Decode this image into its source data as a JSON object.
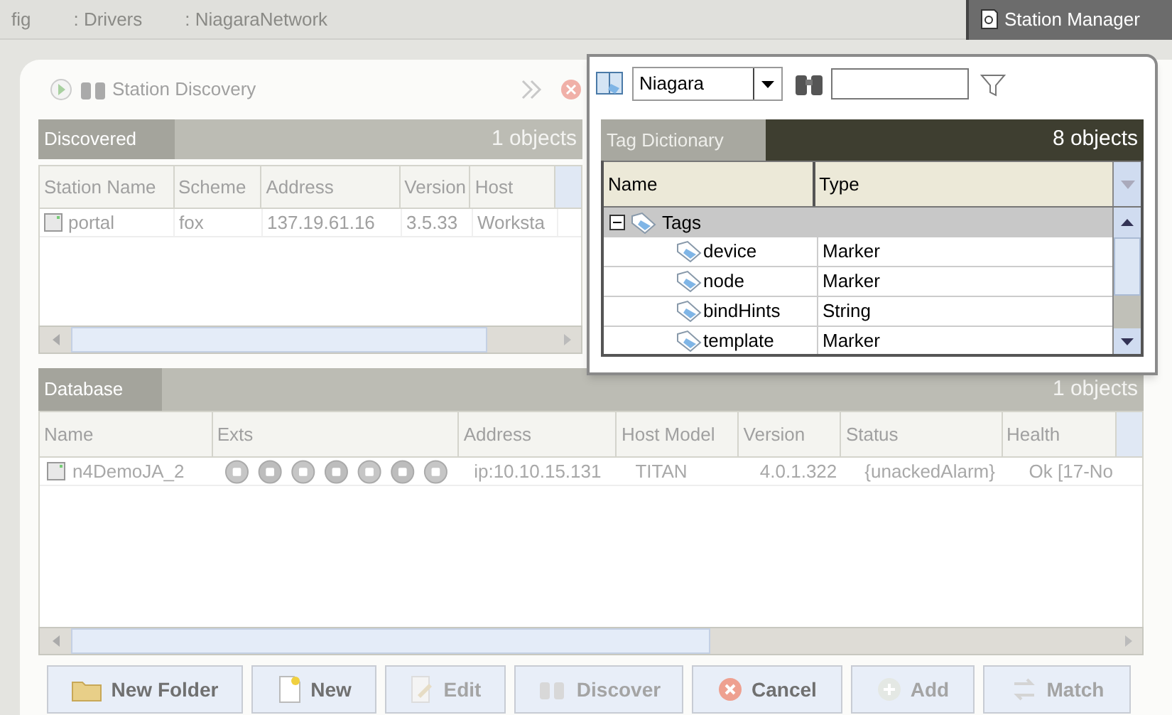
{
  "breadcrumb": [
    "fig",
    ": Drivers",
    ": NiagaraNetwork"
  ],
  "station_manager": "Station Manager",
  "discovery": {
    "title": "Station Discovery",
    "tab": "Discovered",
    "count": "1 objects",
    "columns": [
      "Station Name",
      "Scheme",
      "Address",
      "Version",
      "Host"
    ],
    "rows": [
      [
        "portal",
        "fox",
        "137.19.61.16",
        "3.5.33",
        "Worksta"
      ]
    ]
  },
  "database": {
    "tab": "Database",
    "count": "1 objects",
    "columns": [
      "Name",
      "Exts",
      "Address",
      "Host Model",
      "Version",
      "Status",
      "Health"
    ],
    "rows": [
      {
        "name": "n4DemoJA_2",
        "address": "ip:10.10.15.131",
        "host_model": "TITAN",
        "version": "4.0.1.322",
        "status": "{unackedAlarm}",
        "health": "Ok [17-No"
      }
    ]
  },
  "buttons": [
    {
      "label": "New Folder",
      "kind": "folder",
      "disabled": false
    },
    {
      "label": "New",
      "kind": "new",
      "disabled": false
    },
    {
      "label": "Edit",
      "kind": "edit",
      "disabled": true
    },
    {
      "label": "Discover",
      "kind": "discover",
      "disabled": true
    },
    {
      "label": "Cancel",
      "kind": "cancel",
      "disabled": false
    },
    {
      "label": "Add",
      "kind": "add",
      "disabled": true
    },
    {
      "label": "Match",
      "kind": "match",
      "disabled": true
    }
  ],
  "popup": {
    "dictionary": "Niagara",
    "tab": "Tag Dictionary",
    "count": "8 objects",
    "columns": [
      "Name",
      "Type"
    ],
    "tree": {
      "label": "Tags",
      "expanded": true,
      "children": [
        {
          "name": "device",
          "type": "Marker"
        },
        {
          "name": "node",
          "type": "Marker"
        },
        {
          "name": "bindHints",
          "type": "String"
        },
        {
          "name": "template",
          "type": "Marker"
        }
      ]
    }
  }
}
